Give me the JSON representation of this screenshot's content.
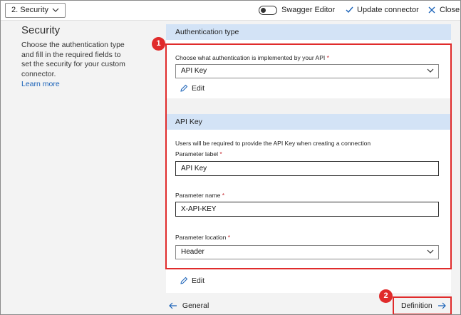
{
  "topbar": {
    "step_select": "2. Security",
    "swagger_toggle_label": "Swagger Editor",
    "update_connector": "Update connector",
    "close": "Close"
  },
  "left": {
    "title": "Security",
    "description": "Choose the authentication type and fill in the required fields to set the security for your custom connector.",
    "learn_more": "Learn more"
  },
  "auth_section": {
    "header": "Authentication type",
    "field_label": "Choose what authentication is implemented by your API",
    "selected": "API Key",
    "edit": "Edit"
  },
  "apikey_section": {
    "header": "API Key",
    "hint": "Users will be required to provide the API Key when creating a connection",
    "param_label_label": "Parameter label",
    "param_label_value": "API Key",
    "param_name_label": "Parameter name",
    "param_name_value": "X-API-KEY",
    "param_location_label": "Parameter location",
    "param_location_value": "Header",
    "edit": "Edit"
  },
  "nav": {
    "back": "General",
    "next": "Definition"
  },
  "callouts": [
    "1",
    "2"
  ],
  "colors": {
    "accent": "#1a62b8",
    "section_header": "#d3e3f6",
    "callout": "#e02b2b",
    "required": "#c4262e"
  }
}
